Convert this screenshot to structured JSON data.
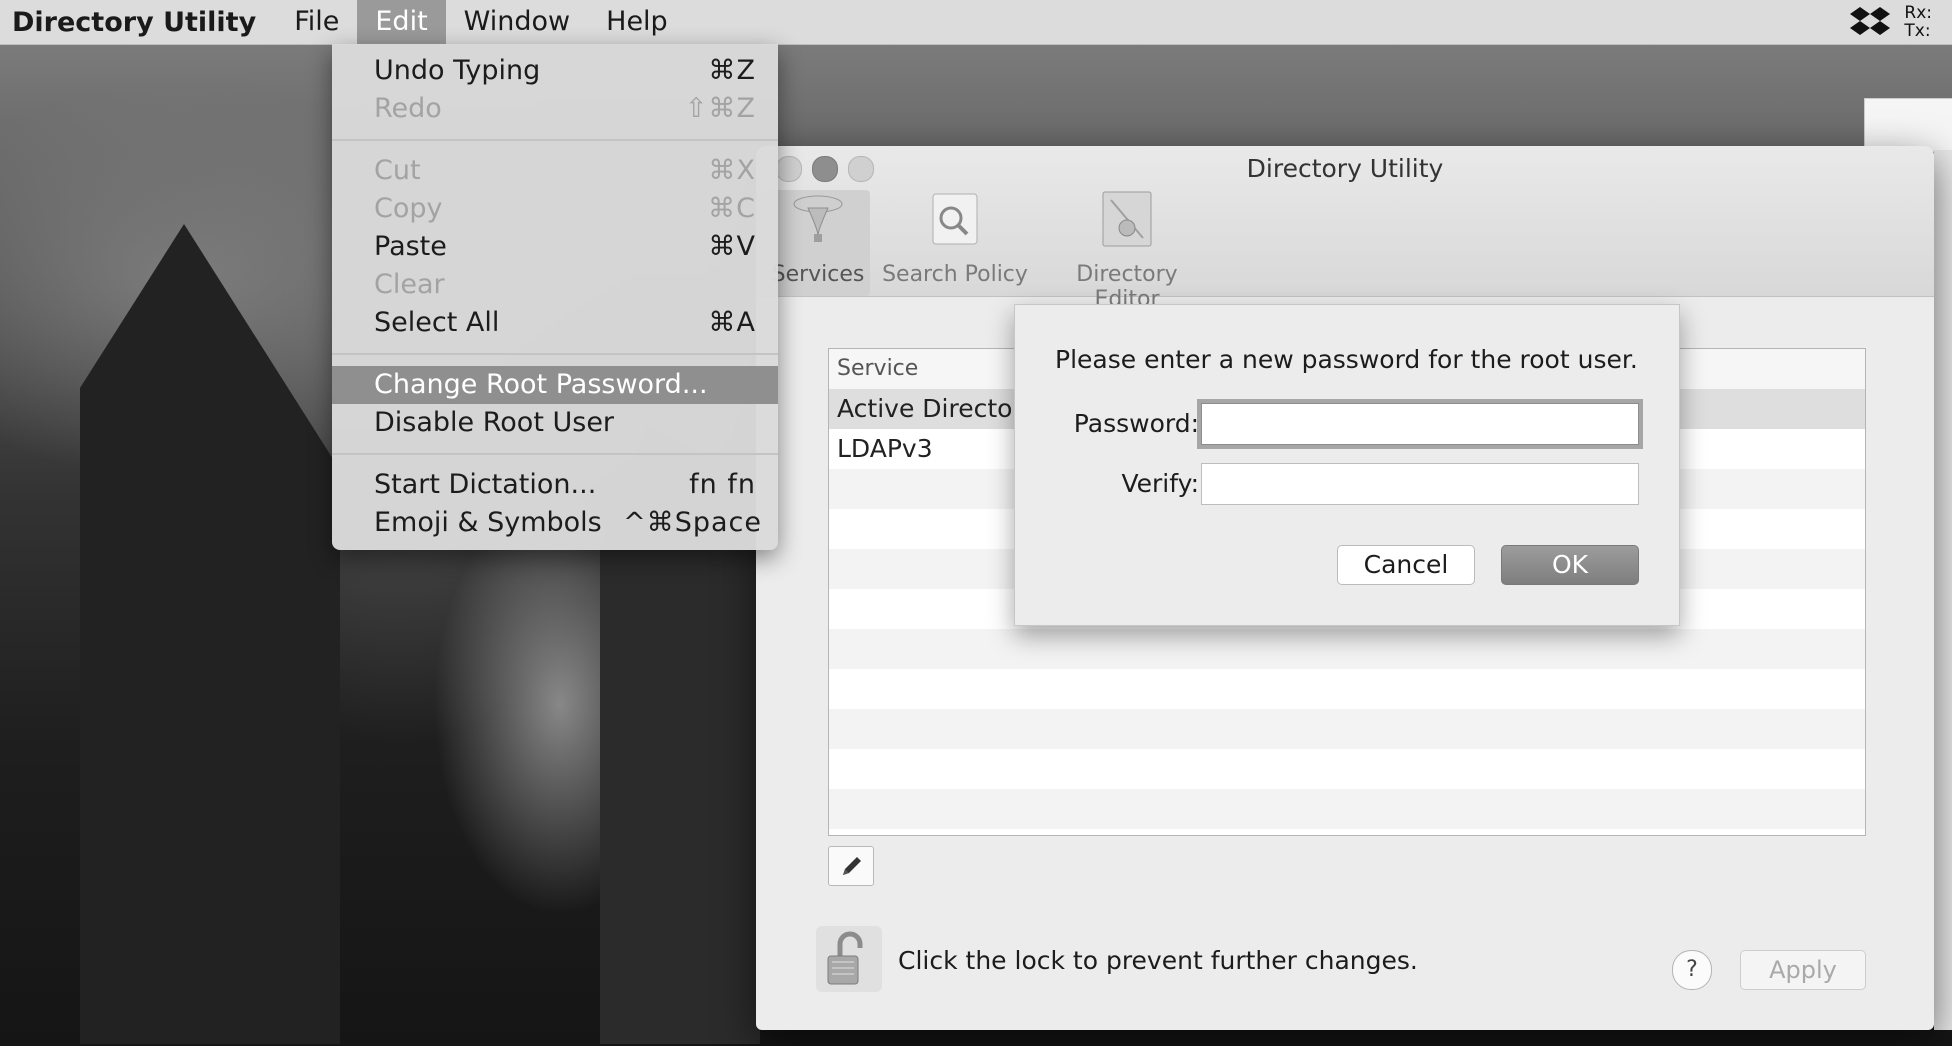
{
  "menubar": {
    "app_name": "Directory Utility",
    "items": [
      "File",
      "Edit",
      "Window",
      "Help"
    ],
    "active": "Edit",
    "rx_label": "Rx:",
    "tx_label": "Tx:"
  },
  "edit_menu": {
    "items": [
      {
        "label": "Undo Typing",
        "shortcut": "⌘Z",
        "enabled": true
      },
      {
        "label": "Redo",
        "shortcut": "⇧⌘Z",
        "enabled": false
      },
      {
        "label": "Cut",
        "shortcut": "⌘X",
        "enabled": false
      },
      {
        "label": "Copy",
        "shortcut": "⌘C",
        "enabled": false
      },
      {
        "label": "Paste",
        "shortcut": "⌘V",
        "enabled": true
      },
      {
        "label": "Clear",
        "shortcut": "",
        "enabled": false
      },
      {
        "label": "Select All",
        "shortcut": "⌘A",
        "enabled": true
      },
      {
        "label": "Change Root Password...",
        "shortcut": "",
        "enabled": true,
        "highlighted": true
      },
      {
        "label": "Disable Root User",
        "shortcut": "",
        "enabled": true
      },
      {
        "label": "Start Dictation...",
        "shortcut": "fn fn",
        "enabled": true
      },
      {
        "label": "Emoji & Symbols",
        "shortcut": "^⌘Space",
        "enabled": true
      }
    ]
  },
  "window": {
    "title": "Directory Utility",
    "toolbar": [
      {
        "label": "Services",
        "selected": true,
        "icon": "services-icon"
      },
      {
        "label": "Search Policy",
        "selected": false,
        "icon": "search-policy-icon"
      },
      {
        "label": "Directory Editor",
        "selected": false,
        "icon": "directory-editor-icon"
      }
    ],
    "table": {
      "header": "Service",
      "rows": [
        "Active Directory",
        "LDAPv3"
      ]
    },
    "lock_text": "Click the lock to prevent further changes.",
    "help_label": "?",
    "apply_label": "Apply"
  },
  "sheet": {
    "message": "Please enter a new password for the root user.",
    "password_label": "Password:",
    "password_value": "",
    "verify_label": "Verify:",
    "verify_value": "",
    "cancel_label": "Cancel",
    "ok_label": "OK"
  },
  "colors": {
    "menu_highlight": "#8f8f8f",
    "ok_button": "#888888"
  }
}
